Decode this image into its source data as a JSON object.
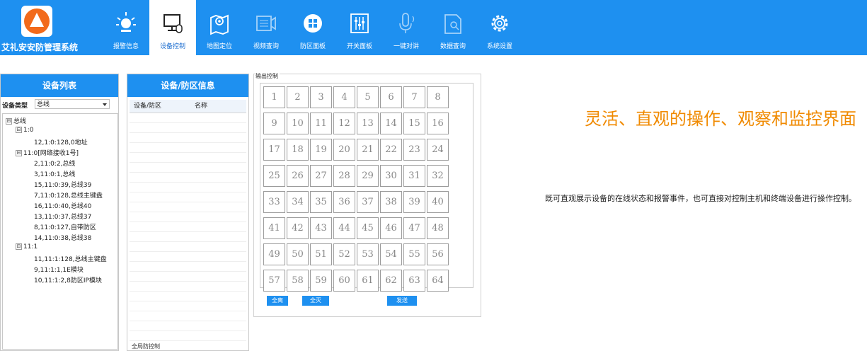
{
  "app": {
    "title": "艾礼安安防管理系统"
  },
  "nav": [
    {
      "label": "报警信息",
      "icon": "alarm-light-icon",
      "active": false
    },
    {
      "label": "设备控制",
      "icon": "device-control-icon",
      "active": true
    },
    {
      "label": "地图定位",
      "icon": "map-location-icon",
      "active": false
    },
    {
      "label": "视频查询",
      "icon": "video-icon",
      "active": false
    },
    {
      "label": "防区面板",
      "icon": "zone-panel-icon",
      "active": false
    },
    {
      "label": "开关面板",
      "icon": "switch-panel-icon",
      "active": false
    },
    {
      "label": "一键对讲",
      "icon": "microphone-icon",
      "active": false
    },
    {
      "label": "数据查询",
      "icon": "data-query-icon",
      "active": false
    },
    {
      "label": "系统设置",
      "icon": "gear-icon",
      "active": false
    }
  ],
  "device_list": {
    "title": "设备列表",
    "type_label": "设备类型",
    "type_value": "总线",
    "tree": [
      {
        "label": "总线",
        "toggle": "⊟"
      },
      {
        "label": "1:0",
        "toggle": "⊟"
      },
      {
        "label": "12,1:0:128,0地址",
        "toggle": ""
      },
      {
        "label": "11:0[网络接收1号]",
        "toggle": "⊟"
      },
      {
        "label": "2,11:0:2,总线",
        "toggle": ""
      },
      {
        "label": "3,11:0:1,总线",
        "toggle": ""
      },
      {
        "label": "15,11:0:39,总线39",
        "toggle": ""
      },
      {
        "label": "7,11:0:128,总线主键盘",
        "toggle": ""
      },
      {
        "label": "16,11:0:40,总线40",
        "toggle": ""
      },
      {
        "label": "13,11:0:37,总线37",
        "toggle": ""
      },
      {
        "label": "8,11:0:127,自带防区",
        "toggle": ""
      },
      {
        "label": "14,11:0:38,总线38",
        "toggle": ""
      },
      {
        "label": "11:1",
        "toggle": "⊟"
      },
      {
        "label": "11,11:1:128,总线主键盘",
        "toggle": ""
      },
      {
        "label": "9,11:1:1,1E模块",
        "toggle": ""
      },
      {
        "label": "10,11:1:2,8防区IP模块",
        "toggle": ""
      }
    ]
  },
  "zone_info": {
    "title": "设备/防区信息",
    "columns": [
      "设备/防区",
      "名称"
    ],
    "footer": "全局防控制"
  },
  "output_control": {
    "title": "输出控制",
    "keys": [
      "1",
      "2",
      "3",
      "4",
      "5",
      "6",
      "7",
      "8",
      "9",
      "10",
      "11",
      "12",
      "13",
      "14",
      "15",
      "16",
      "17",
      "18",
      "19",
      "20",
      "21",
      "22",
      "23",
      "24",
      "25",
      "26",
      "27",
      "28",
      "29",
      "30",
      "31",
      "32",
      "33",
      "34",
      "35",
      "36",
      "37",
      "38",
      "39",
      "40",
      "41",
      "42",
      "43",
      "44",
      "45",
      "46",
      "47",
      "48",
      "49",
      "50",
      "51",
      "52",
      "53",
      "54",
      "55",
      "56",
      "57",
      "58",
      "59",
      "60",
      "61",
      "62",
      "63",
      "64"
    ],
    "btn_all_off": "全离",
    "btn_all_on": "全灭",
    "btn_send": "发送"
  },
  "headline": "灵活、直观的操作、观察和监控界面",
  "description": "既可直观展示设备的在线状态和报警事件，也可直接对控制主机和终端设备进行操作控制。",
  "colors": {
    "primary": "#1e90f0",
    "accent": "#f08a00"
  }
}
